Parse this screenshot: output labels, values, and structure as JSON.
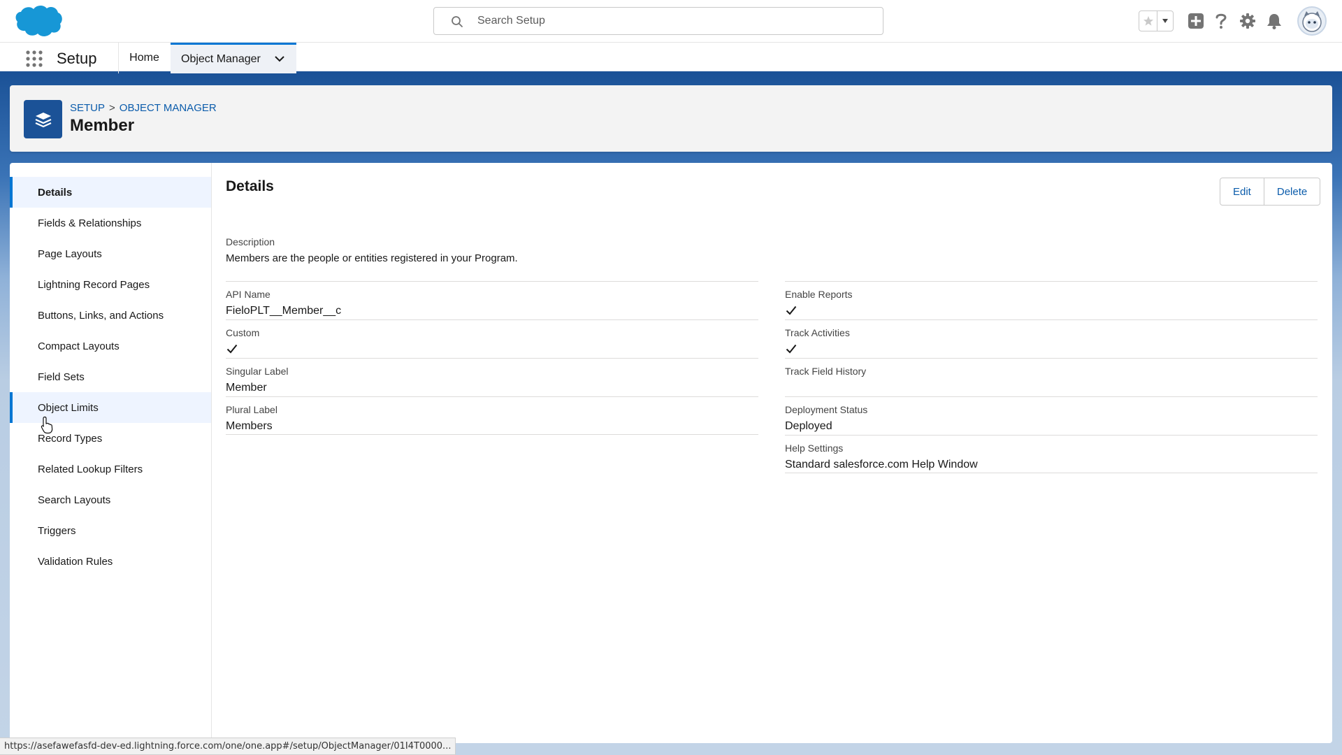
{
  "header": {
    "search_placeholder": "Search Setup"
  },
  "context": {
    "app_name": "Setup",
    "tabs": [
      {
        "label": "Home"
      },
      {
        "label": "Object Manager"
      }
    ]
  },
  "page_header": {
    "breadcrumb": [
      "SETUP",
      "OBJECT MANAGER"
    ],
    "breadcrumb_separator": ">",
    "title": "Member"
  },
  "sidebar": {
    "items": [
      {
        "label": "Details"
      },
      {
        "label": "Fields & Relationships"
      },
      {
        "label": "Page Layouts"
      },
      {
        "label": "Lightning Record Pages"
      },
      {
        "label": "Buttons, Links, and Actions"
      },
      {
        "label": "Compact Layouts"
      },
      {
        "label": "Field Sets"
      },
      {
        "label": "Object Limits"
      },
      {
        "label": "Record Types"
      },
      {
        "label": "Related Lookup Filters"
      },
      {
        "label": "Search Layouts"
      },
      {
        "label": "Triggers"
      },
      {
        "label": "Validation Rules"
      }
    ]
  },
  "details": {
    "title": "Details",
    "edit_label": "Edit",
    "delete_label": "Delete",
    "description_label": "Description",
    "description_value": "Members are the people or entities registered in your Program.",
    "left_fields": [
      {
        "label": "API Name",
        "value": "FieloPLT__Member__c"
      },
      {
        "label": "Custom",
        "value": ""
      },
      {
        "label": "Singular Label",
        "value": "Member"
      },
      {
        "label": "Plural Label",
        "value": "Members"
      }
    ],
    "right_fields": [
      {
        "label": "Enable Reports",
        "value": ""
      },
      {
        "label": "Track Activities",
        "value": ""
      },
      {
        "label": "Track Field History",
        "value": ""
      },
      {
        "label": "Deployment Status",
        "value": "Deployed"
      },
      {
        "label": "Help Settings",
        "value": "Standard salesforce.com Help Window"
      }
    ]
  },
  "status_bar": {
    "url": "https://asefawefasfd-dev-ed.lightning.force.com/one/one.app#/setup/ObjectManager/01I4T0000..."
  },
  "colors": {
    "brand": "#0176d3",
    "header_band": "#1b5297",
    "link": "#0b5cab"
  }
}
